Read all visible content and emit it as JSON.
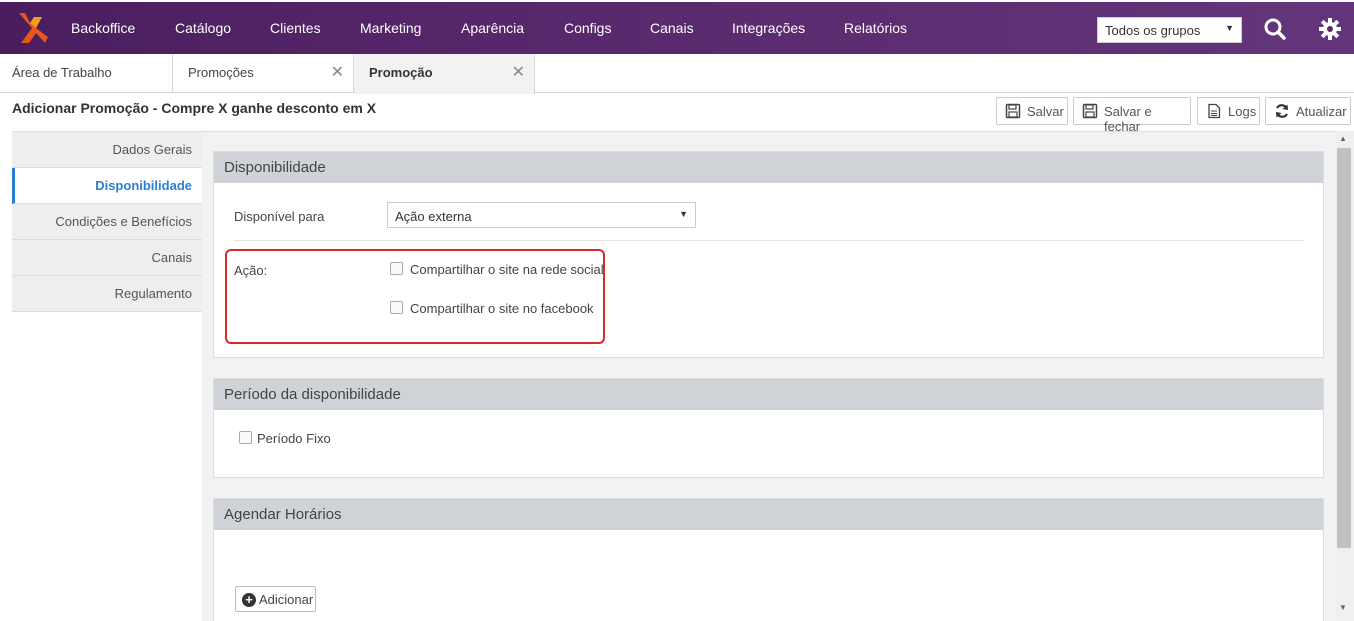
{
  "nav": {
    "items": [
      "Backoffice",
      "Catálogo",
      "Clientes",
      "Marketing",
      "Aparência",
      "Configs",
      "Canais",
      "Integrações",
      "Relatórios"
    ],
    "group_select": "Todos os grupos"
  },
  "tabs": [
    {
      "label": "Área de Trabalho"
    },
    {
      "label": "Promoções"
    },
    {
      "label": "Promoção"
    }
  ],
  "page_title": "Adicionar Promoção - Compre X ganhe desconto em X",
  "toolbar": {
    "save": "Salvar",
    "save_close": "Salvar e fechar",
    "logs": "Logs",
    "refresh": "Atualizar"
  },
  "sidebar": {
    "items": [
      "Dados Gerais",
      "Disponibilidade",
      "Condições e Benefícios",
      "Canais",
      "Regulamento"
    ]
  },
  "availability": {
    "title": "Disponibilidade",
    "available_for_label": "Disponível para",
    "available_for_value": "Ação externa",
    "action_label": "Ação:",
    "options": [
      "Compartilhar o site na rede social",
      "Compartilhar o site no facebook"
    ]
  },
  "period": {
    "title": "Período da disponibilidade",
    "fixed_label": "Período Fixo"
  },
  "schedule": {
    "title": "Agendar Horários",
    "add_label": "Adicionar"
  }
}
